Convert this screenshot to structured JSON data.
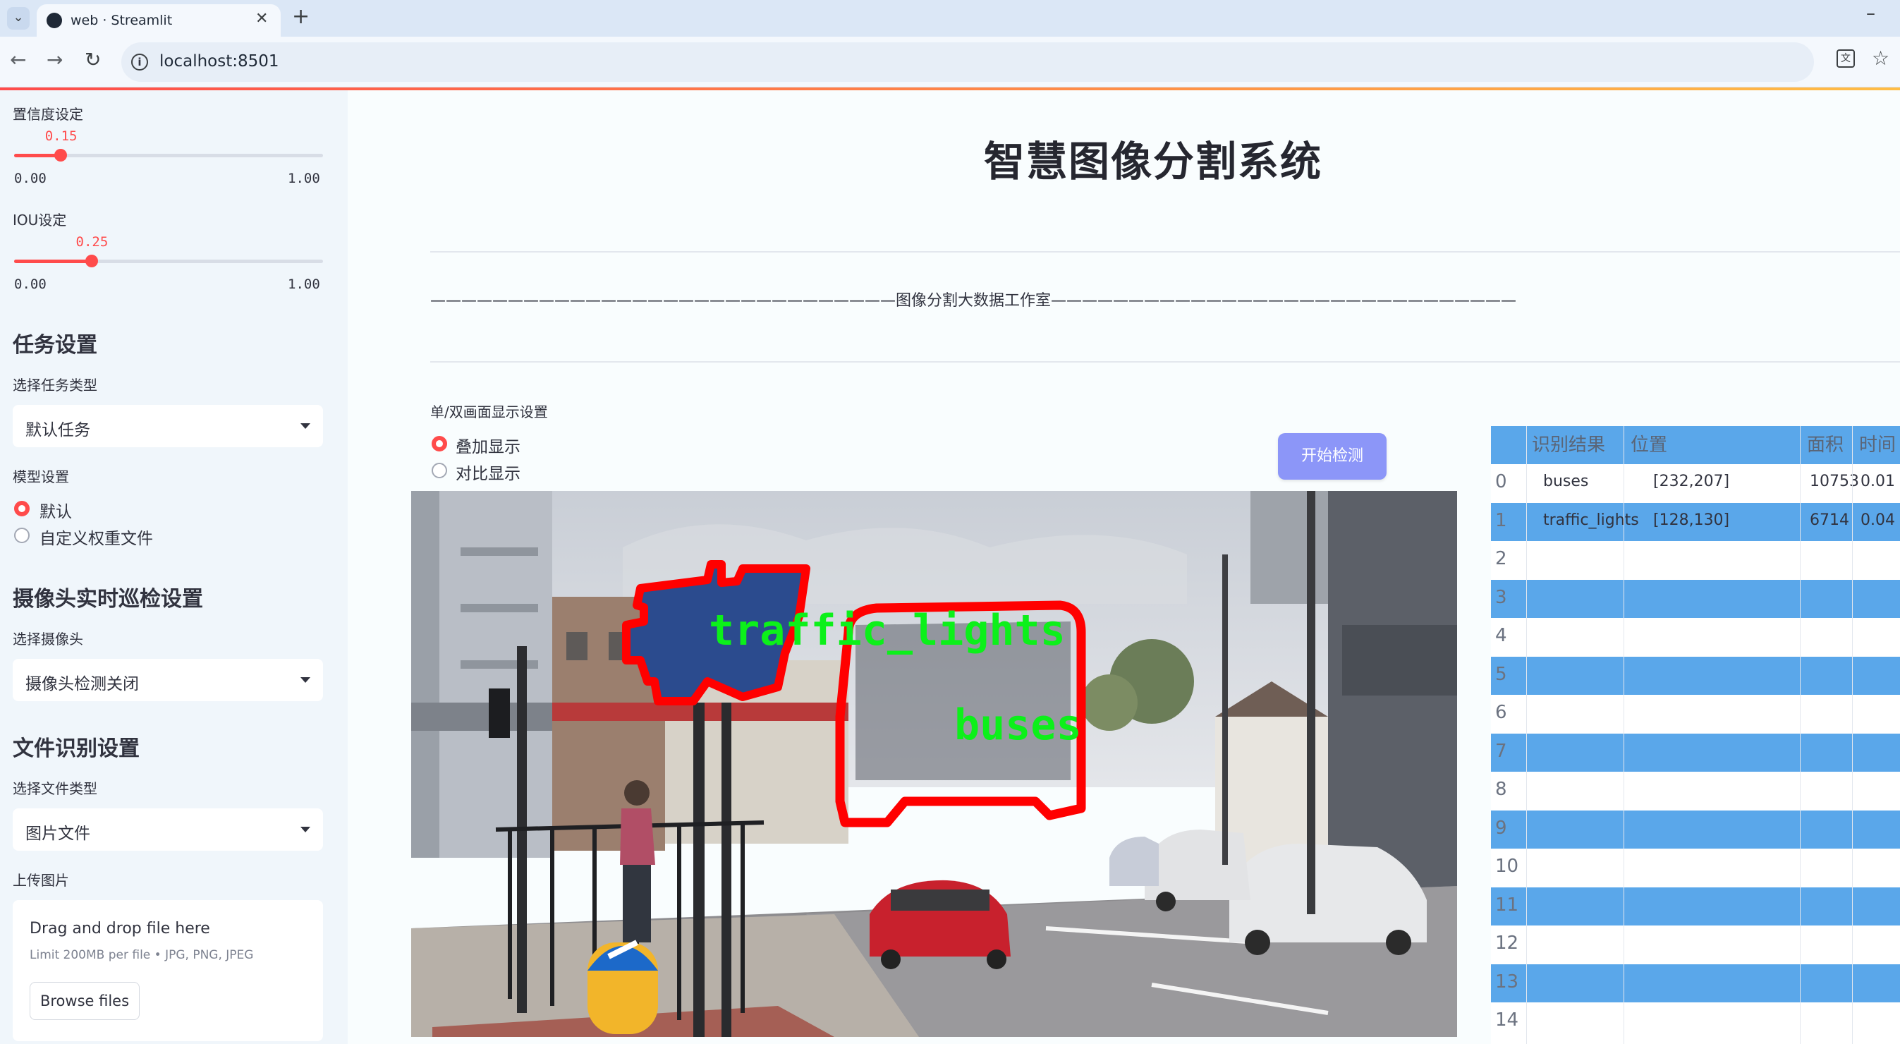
{
  "browser": {
    "tab_title": "web · Streamlit",
    "url": "localhost:8501"
  },
  "sidebar": {
    "confidence": {
      "label": "置信度设定",
      "value": "0.15",
      "value_fraction": 0.15,
      "min": "0.00",
      "max": "1.00"
    },
    "iou": {
      "label": "IOU设定",
      "value": "0.25",
      "value_fraction": 0.25,
      "min": "0.00",
      "max": "1.00"
    },
    "task_section": {
      "heading": "任务设置",
      "task_type_label": "选择任务类型",
      "task_type_value": "默认任务",
      "model_label": "模型设置",
      "model_options": [
        {
          "label": "默认",
          "selected": true
        },
        {
          "label": "自定义权重文件",
          "selected": false
        }
      ]
    },
    "camera_section": {
      "heading": "摄像头实时巡检设置",
      "camera_label": "选择摄像头",
      "camera_value": "摄像头检测关闭"
    },
    "file_section": {
      "heading": "文件识别设置",
      "file_type_label": "选择文件类型",
      "file_type_value": "图片文件",
      "upload_label": "上传图片",
      "drop_text": "Drag and drop file here",
      "limit_text": "Limit 200MB per file • JPG, PNG, JPEG",
      "browse_label": "Browse files"
    }
  },
  "main": {
    "title": "智慧图像分割系统",
    "subtitle": "——————————————————————————————图像分割大数据工作室——————————————————————————————",
    "display_mode_label": "单/双画面显示设置",
    "display_options": [
      {
        "label": "叠加显示",
        "selected": true
      },
      {
        "label": "对比显示",
        "selected": false
      }
    ],
    "start_button": "开始检测",
    "detections": [
      {
        "label": "traffic_lights",
        "color": "#0cf01a"
      },
      {
        "label": "buses",
        "color": "#0cf01a"
      }
    ]
  },
  "table": {
    "columns": [
      "识别结果",
      "位置",
      "面积",
      "时间"
    ],
    "rows": [
      {
        "index": "0",
        "result": "buses",
        "position": "[232,207]",
        "area": "10753",
        "time": "0.01"
      },
      {
        "index": "1",
        "result": "traffic_lights",
        "position": "[128,130]",
        "area": "6714",
        "time": "0.04"
      },
      {
        "index": "2"
      },
      {
        "index": "3"
      },
      {
        "index": "4"
      },
      {
        "index": "5"
      },
      {
        "index": "6"
      },
      {
        "index": "7"
      },
      {
        "index": "8"
      },
      {
        "index": "9"
      },
      {
        "index": "10"
      },
      {
        "index": "11"
      },
      {
        "index": "12"
      },
      {
        "index": "13"
      },
      {
        "index": "14"
      }
    ]
  },
  "colors": {
    "accent": "#ff4b4b",
    "button": "#8c96f8",
    "table_stripe": "#5aa7ea",
    "mask_outline": "#ff0000",
    "mask_fill": "#2c4a8c"
  }
}
